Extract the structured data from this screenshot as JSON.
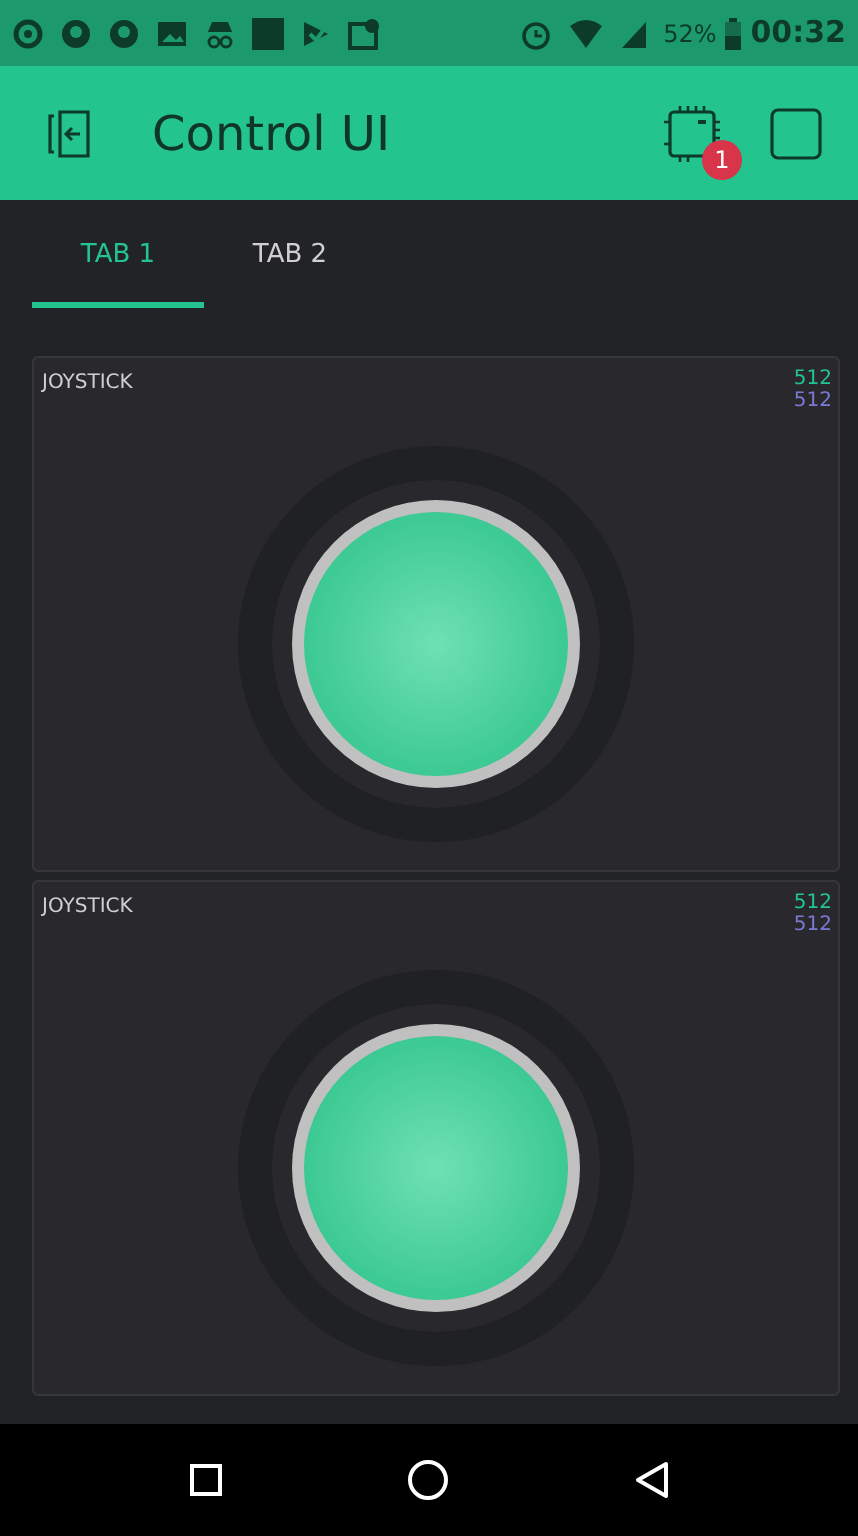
{
  "status_bar": {
    "battery": "52%",
    "time": "00:32"
  },
  "header": {
    "title": "Control UI",
    "badge": "1"
  },
  "tabs": [
    {
      "label": "TAB 1",
      "selected": true
    },
    {
      "label": "TAB 2",
      "selected": false
    }
  ],
  "widgets": [
    {
      "label": "JOYSTICK",
      "x_value": "512",
      "y_value": "512"
    },
    {
      "label": "JOYSTICK",
      "x_value": "512",
      "y_value": "512"
    }
  ]
}
